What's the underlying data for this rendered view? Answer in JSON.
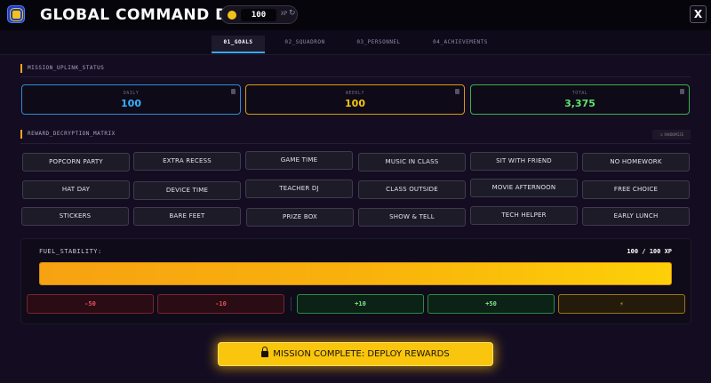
{
  "header": {
    "title": "GLOBAL COMMAND DECK",
    "xp_value": "100",
    "xp_label": "XP",
    "close_label": "X",
    "logo_icon": "chip-logo-icon",
    "coin_icon": "coin-icon",
    "reset_icon": "reset-icon"
  },
  "tabs": [
    {
      "label": "01_GOALS",
      "active": true
    },
    {
      "label": "02_SQUADRON",
      "active": false
    },
    {
      "label": "03_PERSONNEL",
      "active": false
    },
    {
      "label": "04_ACHIEVEMENTS",
      "active": false
    }
  ],
  "mission_status": {
    "heading": "MISSION_UPLINK_STATUS",
    "cards": [
      {
        "label": "DAILY",
        "value": "100",
        "color": "#38b0ff",
        "border": "#2a8fd0"
      },
      {
        "label": "WEEKLY",
        "value": "100",
        "color": "#f9c50d",
        "border": "#d99c10"
      },
      {
        "label": "TOTAL",
        "value": "3,375",
        "color": "#5fe36d",
        "border": "#3cb24a"
      }
    ]
  },
  "reward_matrix": {
    "heading": "REWARD_DECRYPTION_MATRIX",
    "randomize_label": "⤨ RANDOMIZE",
    "rewards": [
      "POPCORN PARTY",
      "EXTRA RECESS",
      "GAME TIME",
      "MUSIC IN CLASS",
      "SIT WITH FRIEND",
      "NO HOMEWORK",
      "HAT DAY",
      "DEVICE TIME",
      "TEACHER DJ",
      "CLASS OUTSIDE",
      "MOVIE AFTERNOON",
      "FREE CHOICE",
      "STICKERS",
      "BARE FEET",
      "PRIZE BOX",
      "SHOW & TELL",
      "TECH HELPER",
      "EARLY LUNCH"
    ]
  },
  "fuel": {
    "label": "FUEL_STABILITY:",
    "readout": "100 / 100 XP",
    "current": 100,
    "max": 100
  },
  "adjusters": [
    {
      "label": "-50",
      "kind": "neg"
    },
    {
      "label": "-10",
      "kind": "neg"
    },
    {
      "label": "+10",
      "kind": "pos"
    },
    {
      "label": "+50",
      "kind": "pos"
    },
    {
      "label": "⚡",
      "kind": "bolt"
    }
  ],
  "deploy": {
    "label": "MISSION COMPLETE: DEPLOY REWARDS",
    "icon": "lock-icon"
  },
  "colors": {
    "accent": "#f9c50d",
    "tab_underline": "#3aa8e8",
    "background": "#140d22"
  }
}
